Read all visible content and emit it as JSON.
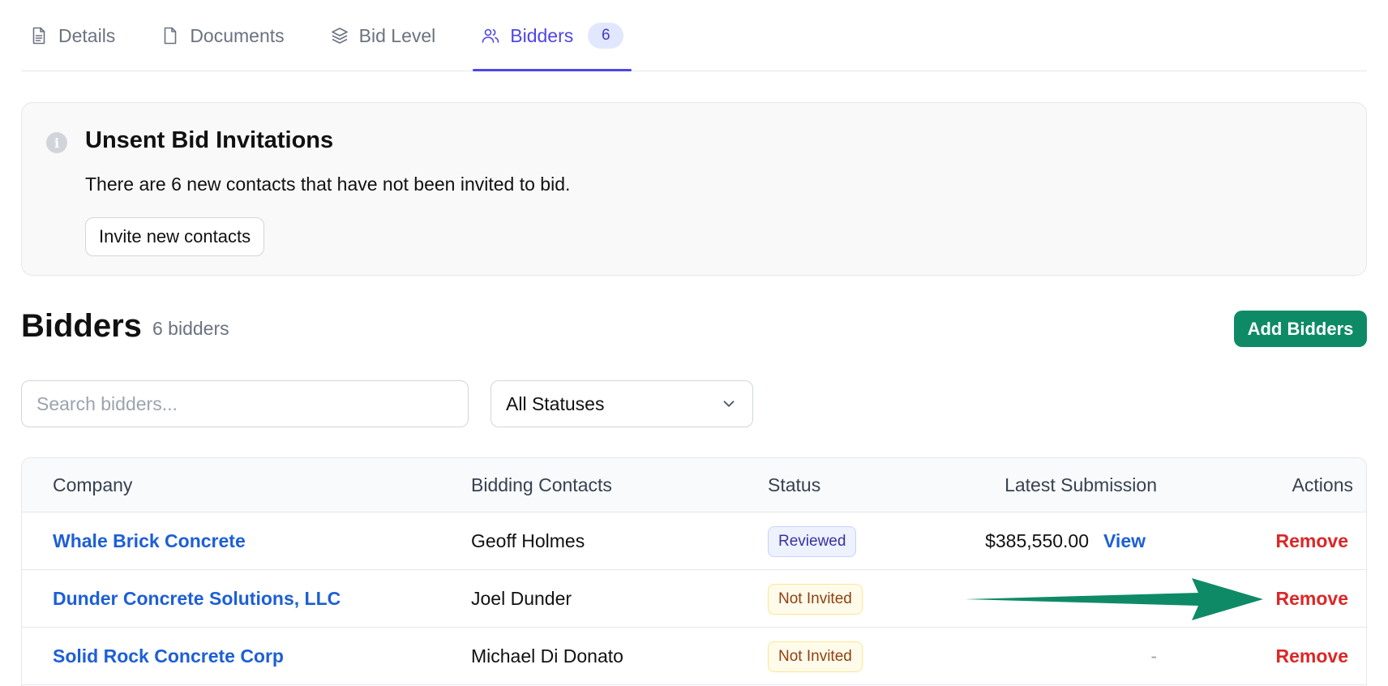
{
  "tabs": [
    {
      "label": "Details",
      "icon": "document-text-icon"
    },
    {
      "label": "Documents",
      "icon": "document-icon"
    },
    {
      "label": "Bid Level",
      "icon": "layers-icon"
    },
    {
      "label": "Bidders",
      "icon": "users-icon",
      "count": "6",
      "active": true
    }
  ],
  "alert": {
    "icon": "info-icon",
    "title": "Unsent Bid Invitations",
    "text": "There are 6 new contacts that have not been invited to bid.",
    "button_label": "Invite new contacts"
  },
  "section": {
    "title": "Bidders",
    "count": "6 bidders",
    "add_button_label": "Add Bidders"
  },
  "filters": {
    "search_placeholder": "Search bidders...",
    "status_selected": "All Statuses"
  },
  "table": {
    "columns": [
      "Company",
      "Bidding Contacts",
      "Status",
      "Latest Submission",
      "Actions"
    ],
    "rows": [
      {
        "company": "Whale Brick Concrete",
        "contact": "Geoff Holmes",
        "status": "Reviewed",
        "amount": "$385,550.00",
        "view": "View",
        "action": "Remove"
      },
      {
        "company": "Dunder Concrete Solutions, LLC",
        "contact": "Joel Dunder",
        "status": "Not Invited",
        "amount": "",
        "view": "",
        "action": "Remove"
      },
      {
        "company": "Solid Rock Concrete Corp",
        "contact": "Michael Di Donato",
        "status": "Not Invited",
        "amount": "-",
        "view": "",
        "action": "Remove"
      }
    ]
  },
  "colors": {
    "accent": "#4f46e5",
    "primary_button": "#0f8a67",
    "link": "#1d5fd6",
    "danger": "#dc2626",
    "annotation_arrow": "#0f8a67"
  }
}
